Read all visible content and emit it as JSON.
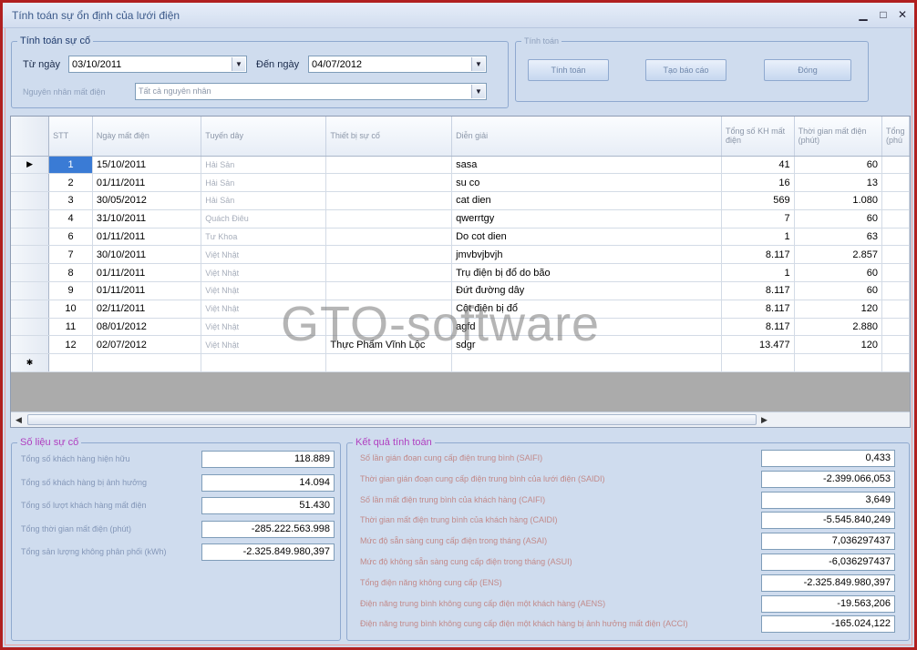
{
  "window": {
    "title": "Tính toán sự ổn định của lưới điện",
    "minimize": "▁",
    "maximize": "□",
    "close": "✕"
  },
  "filter": {
    "legend": "Tính toán sự cố",
    "from_label": "Từ ngày",
    "from_value": "03/10/2011",
    "to_label": "Đến ngày",
    "to_value": "04/07/2012",
    "cause_label": "Nguyên nhân mất điện",
    "cause_value": "Tất cả nguyên nhân"
  },
  "actions": {
    "legend": "Tính toán",
    "calc_label": "Tính toán",
    "report_label": "Tạo báo cáo",
    "close_label": "Đóng"
  },
  "grid": {
    "columns": [
      "STT",
      "Ngày mất điện",
      "Tuyến dây",
      "Thiết bị sự cố",
      "Diễn giải",
      "Tổng số KH mất điện",
      "Thời gian mất điện (phút)",
      "Tổng (phú"
    ],
    "rows": [
      {
        "stt": "1",
        "date": "15/10/2011",
        "line": "Hải Sản",
        "device": "",
        "desc": "sasa",
        "kh": "41",
        "time": "60"
      },
      {
        "stt": "2",
        "date": "01/11/2011",
        "line": "Hải Sản",
        "device": "",
        "desc": "su co",
        "kh": "16",
        "time": "13"
      },
      {
        "stt": "3",
        "date": "30/05/2012",
        "line": "Hải Sản",
        "device": "",
        "desc": "cat dien",
        "kh": "569",
        "time": "1.080"
      },
      {
        "stt": "4",
        "date": "31/10/2011",
        "line": "Quách Điêu",
        "device": "",
        "desc": "qwerrtgy",
        "kh": "7",
        "time": "60"
      },
      {
        "stt": "6",
        "date": "01/11/2011",
        "line": "Tư Khoa",
        "device": "",
        "desc": "Do cot dien",
        "kh": "1",
        "time": "63"
      },
      {
        "stt": "7",
        "date": "30/10/2011",
        "line": "Việt Nhật",
        "device": "",
        "desc": "jmvbvjbvjh",
        "kh": "8.117",
        "time": "2.857"
      },
      {
        "stt": "8",
        "date": "01/11/2011",
        "line": "Việt Nhật",
        "device": "",
        "desc": "Trụ điện bị đổ do bão",
        "kh": "1",
        "time": "60"
      },
      {
        "stt": "9",
        "date": "01/11/2011",
        "line": "Việt Nhật",
        "device": "",
        "desc": "Đứt đường dây",
        "kh": "8.117",
        "time": "60"
      },
      {
        "stt": "10",
        "date": "02/11/2011",
        "line": "Việt Nhật",
        "device": "",
        "desc": "Cột điện bị đổ",
        "kh": "8.117",
        "time": "120"
      },
      {
        "stt": "11",
        "date": "08/01/2012",
        "line": "Việt Nhật",
        "device": "",
        "desc": "agfd",
        "kh": "8.117",
        "time": "2.880"
      },
      {
        "stt": "12",
        "date": "02/07/2012",
        "line": "Việt Nhật",
        "device": "Thực Phẩm Vĩnh Lộc",
        "desc": "sdgr",
        "kh": "13.477",
        "time": "120"
      }
    ],
    "current_row_marker": "▶",
    "new_row_marker": "✱"
  },
  "stats": {
    "legend": "Số liệu sự cố",
    "items": [
      {
        "label": "Tổng số khách hàng hiện hữu",
        "value": "118.889"
      },
      {
        "label": "Tổng số khách hàng bị ảnh hưởng",
        "value": "14.094"
      },
      {
        "label": "Tổng số lượt khách hàng mất điện",
        "value": "51.430"
      },
      {
        "label": "Tổng thời gian mất điện (phút)",
        "value": "-285.222.563.998"
      },
      {
        "label": "Tổng sản lượng không phân phối (kWh)",
        "value": "-2.325.849.980,397"
      }
    ]
  },
  "results": {
    "legend": "Kết quả tính toán",
    "items": [
      {
        "label": "Số lần gián đoạn cung cấp điện trung bình (SAIFI)",
        "value": "0,433"
      },
      {
        "label": "Thời gian gián đoạn cung cấp điện trung bình của lưới điện (SAIDI)",
        "value": "-2.399.066,053"
      },
      {
        "label": "Số lần mất điện trung bình của khách hàng (CAIFI)",
        "value": "3,649"
      },
      {
        "label": "Thời gian mất điện trung bình của khách hàng (CAIDI)",
        "value": "-5.545.840,249"
      },
      {
        "label": "Mức độ sẵn sàng cung cấp điện trong tháng (ASAI)",
        "value": "7,036297437"
      },
      {
        "label": "Mức độ không sẵn sàng cung cấp điện trong tháng (ASUI)",
        "value": "-6,036297437"
      },
      {
        "label": "Tổng điện năng không cung cấp (ENS)",
        "value": "-2.325.849.980,397"
      },
      {
        "label": "Điện năng trung bình không cung cấp điện một khách hàng (AENS)",
        "value": "-19.563,206"
      },
      {
        "label": "Điện năng trung bình không cung cấp điện một khách hàng bị ảnh hưởng mất điện (ACCI)",
        "value": "-165.024,122"
      }
    ]
  },
  "watermark": "GTO-software"
}
